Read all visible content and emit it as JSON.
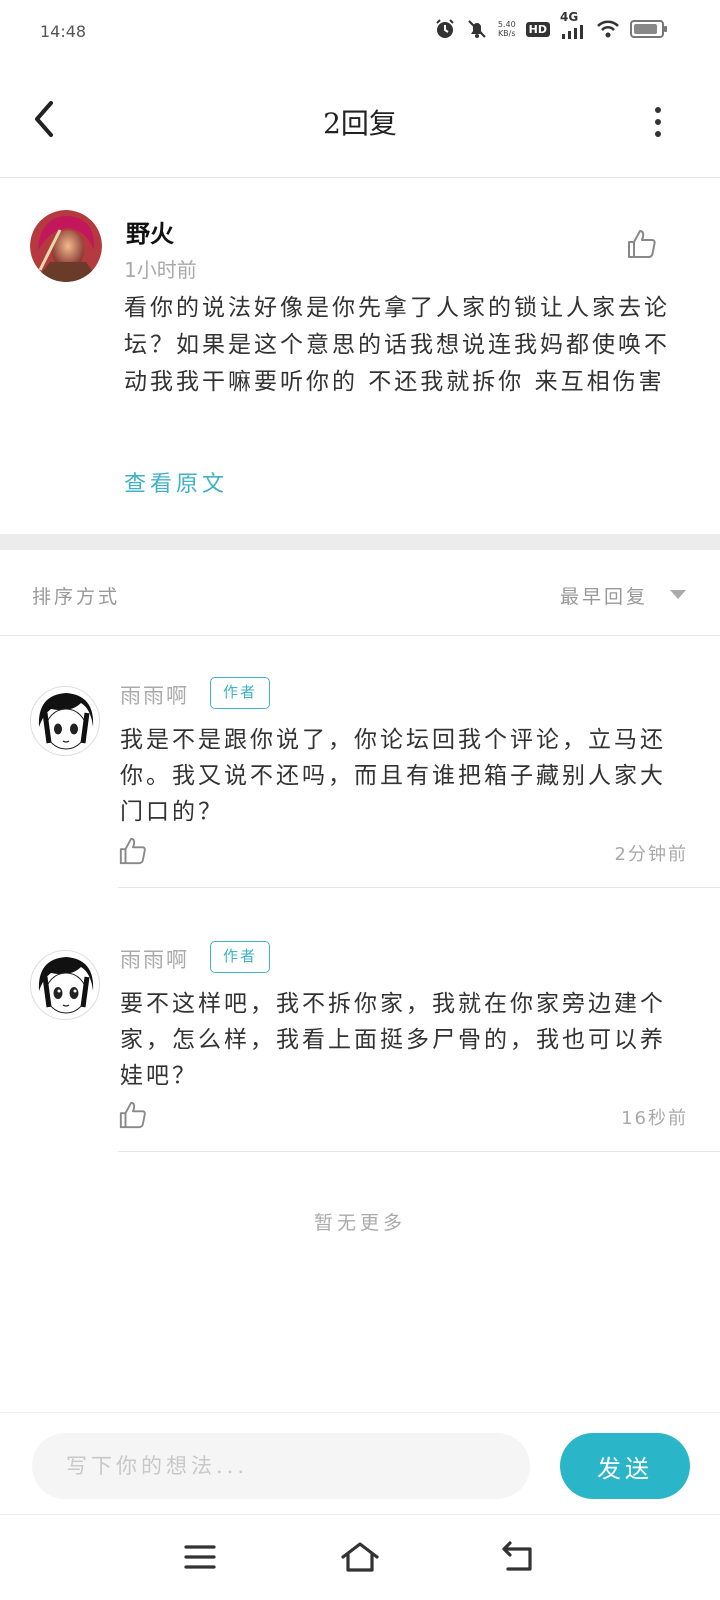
{
  "status_bar": {
    "time": "14:48",
    "net_speed_value": "5.40",
    "net_speed_unit": "KB/s",
    "hd_label": "HD",
    "network_label": "4G"
  },
  "header": {
    "title": "2回复"
  },
  "original_comment": {
    "author": "野火",
    "time": "1小时前",
    "text": "看你的说法好像是你先拿了人家的锁让人家去论坛？如果是这个意思的话我想说连我妈都使唤不动我我干嘛要听你的 不还我就拆你 来互相伤害",
    "view_original_label": "查看原文"
  },
  "sort": {
    "label": "排序方式",
    "value": "最早回复"
  },
  "replies": [
    {
      "author": "雨雨啊",
      "badge": "作者",
      "text": "我是不是跟你说了，你论坛回我个评论，立马还你。我又说不还吗，而且有谁把箱子藏别人家大门口的？",
      "time": "2分钟前"
    },
    {
      "author": "雨雨啊",
      "badge": "作者",
      "text": "要不这样吧，我不拆你家，我就在你家旁边建个家，怎么样，我看上面挺多尸骨的，我也可以养娃吧？",
      "time": "16秒前"
    }
  ],
  "no_more_label": "暂无更多",
  "input": {
    "placeholder": "写下你的想法...",
    "send_label": "发送"
  },
  "colors": {
    "accent": "#2bb5c8",
    "link": "#3fb2c5"
  },
  "battery_level_percent": 90
}
